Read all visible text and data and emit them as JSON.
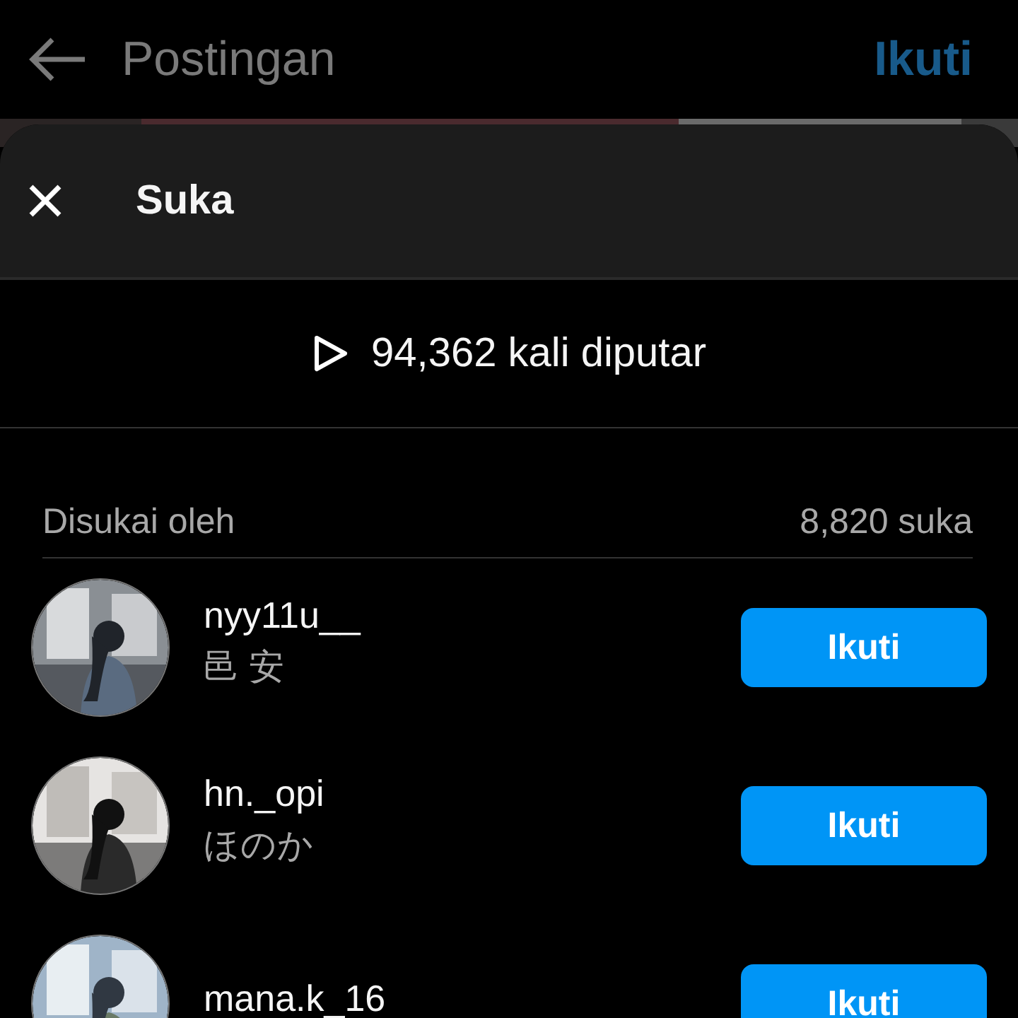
{
  "top_bar": {
    "title": "Postingan",
    "follow": "Ikuti"
  },
  "sheet": {
    "title": "Suka",
    "plays": "94,362 kali diputar",
    "liked_by": "Disukai oleh",
    "like_count": "8,820 suka",
    "users": [
      {
        "username": "nyy11u__",
        "name": "邑 安",
        "button": "Ikuti"
      },
      {
        "username": "hn._opi",
        "name": "ほのか",
        "button": "Ikuti"
      },
      {
        "username": "mana.k_16",
        "button": "Ikuti"
      }
    ]
  }
}
